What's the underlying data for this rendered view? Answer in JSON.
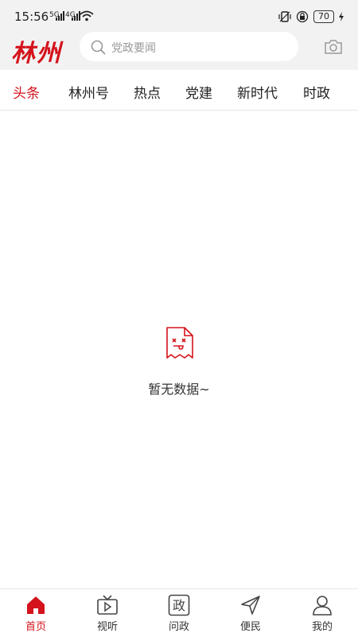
{
  "status": {
    "time": "15:56",
    "sig1": "5G",
    "sig2": "4G",
    "battery": "70"
  },
  "header": {
    "logo": "林州",
    "search_placeholder": "党政要闻"
  },
  "tabs": [
    {
      "label": "头条",
      "active": true
    },
    {
      "label": "林州号"
    },
    {
      "label": "热点"
    },
    {
      "label": "党建"
    },
    {
      "label": "新时代"
    },
    {
      "label": "时政"
    }
  ],
  "empty": {
    "text": "暂无数据~"
  },
  "nav": [
    {
      "label": "首页",
      "icon": "home-icon",
      "active": true
    },
    {
      "label": "视听",
      "icon": "tv-icon"
    },
    {
      "label": "问政",
      "icon": "zheng-icon",
      "glyph": "政"
    },
    {
      "label": "便民",
      "icon": "send-icon"
    },
    {
      "label": "我的",
      "icon": "user-icon"
    }
  ],
  "colors": {
    "accent": "#d4131c",
    "header_bg": "#f2f2f2"
  }
}
